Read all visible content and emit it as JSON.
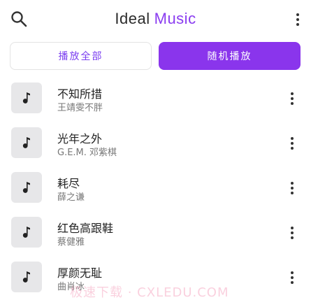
{
  "header": {
    "title_part1": "Ideal",
    "title_part2": "Music"
  },
  "actions": {
    "play_all_label": "播放全部",
    "shuffle_label": "随机播放"
  },
  "songs": [
    {
      "title": "不知所措",
      "artist": "王靖雯不胖"
    },
    {
      "title": "光年之外",
      "artist": "G.E.M. 邓紫棋"
    },
    {
      "title": "耗尽",
      "artist": "薛之谦"
    },
    {
      "title": "红色高跟鞋",
      "artist": "蔡健雅"
    },
    {
      "title": "厚颜无耻",
      "artist": "曲肖冰"
    }
  ],
  "watermark": "极速下载 · CXLEDU.COM",
  "icons": {
    "search": "search-icon",
    "more": "more-vertical-icon",
    "note": "music-note-icon"
  },
  "colors": {
    "accent": "#8a35ec",
    "accent_text": "#7b3ff0",
    "thumb_bg": "#e7e7e9"
  }
}
